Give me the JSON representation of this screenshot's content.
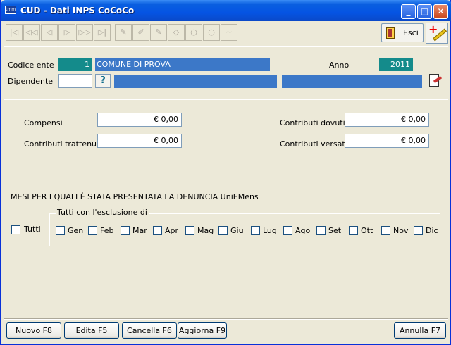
{
  "window": {
    "title": "CUD - Dati INPS CoCoCo",
    "app_icon_text": "tmm",
    "minimize": "_",
    "maximize": "□",
    "close": "✕"
  },
  "toolbar": {
    "tools": [
      {
        "name": "first-record-icon",
        "glyph": "|◁"
      },
      {
        "name": "prev-page-icon",
        "glyph": "◁◁"
      },
      {
        "name": "prev-record-icon",
        "glyph": "◁"
      },
      {
        "name": "next-record-icon",
        "glyph": "▷"
      },
      {
        "name": "next-page-icon",
        "glyph": "▷▷"
      },
      {
        "name": "last-record-icon",
        "glyph": "▷|"
      },
      {
        "name": "add-record-icon",
        "glyph": "✎"
      },
      {
        "name": "edit-record-icon",
        "glyph": "✐"
      },
      {
        "name": "delete-record-icon",
        "glyph": "✎"
      },
      {
        "name": "eraser-icon",
        "glyph": "◇"
      },
      {
        "name": "search-icon",
        "glyph": "○"
      },
      {
        "name": "search-advanced-icon",
        "glyph": "○"
      },
      {
        "name": "undo-icon",
        "glyph": "∼"
      }
    ],
    "esci_label": "Esci"
  },
  "header": {
    "codice_ente_label": "Codice ente",
    "codice_ente_value": "1",
    "ente_name": "COMUNE DI PROVA",
    "anno_label": "Anno",
    "anno_value": "2011",
    "dipendente_label": "Dipendente",
    "dipendente_value": "",
    "lookup_button": "?"
  },
  "amounts": {
    "compensi_label": "Compensi",
    "compensi_value": "€ 0,00",
    "contributi_trattenuti_label": "Contributi trattenuti",
    "contributi_trattenuti_value": "€ 0,00",
    "contributi_dovuti_label": "Contributi dovuti",
    "contributi_dovuti_value": "€ 0,00",
    "contributi_versati_label": "Contributi versati",
    "contributi_versati_value": "€ 0,00"
  },
  "months": {
    "section_title": "MESI PER I QUALI È STATA PRESENTATA LA DENUNCIA UniEMens",
    "tutti_label": "Tutti",
    "group_title": "Tutti con l'esclusione di",
    "items": [
      "Gen",
      "Feb",
      "Mar",
      "Apr",
      "Mag",
      "Giu",
      "Lug",
      "Ago",
      "Set",
      "Ott",
      "Nov",
      "Dic"
    ]
  },
  "footer": {
    "nuovo": "Nuovo  F8",
    "edita": "Edita  F5",
    "cancella": "Cancella  F6",
    "aggiorna": "Aggiorna  F9",
    "annulla": "Annulla  F7"
  }
}
